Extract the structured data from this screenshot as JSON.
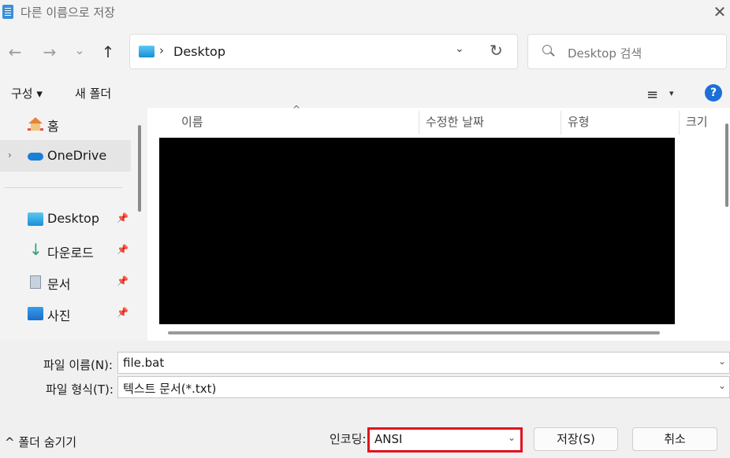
{
  "window": {
    "title": "다른 이름으로 저장",
    "close_glyph": "✕"
  },
  "nav": {
    "back": "←",
    "forward": "→",
    "recent": "⌄",
    "up": "↑",
    "address_sep": "›",
    "address": "Desktop",
    "address_dd": "⌄",
    "refresh": "↻",
    "search_placeholder": "Desktop 검색"
  },
  "commands": {
    "organize": "구성 ▾",
    "new_folder": "새 폴더",
    "view_icon": "≡",
    "view_dd": "▾",
    "help": "?"
  },
  "sidebar": {
    "items": [
      {
        "label": "홈",
        "icon": "home-icon"
      },
      {
        "label": "OneDrive",
        "icon": "onedrive-icon",
        "expander": "›"
      },
      {
        "label": "Desktop",
        "icon": "desktop-folder-icon",
        "pin": "📌"
      },
      {
        "label": "다운로드",
        "icon": "download-icon",
        "pin": "📌"
      },
      {
        "label": "문서",
        "icon": "document-icon",
        "pin": "📌"
      },
      {
        "label": "사진",
        "icon": "pictures-icon",
        "pin": "📌"
      }
    ]
  },
  "columns": [
    "이름",
    "수정한 날짜",
    "유형",
    "크기"
  ],
  "sort_arrow": "^",
  "form": {
    "filename_label": "파일 이름(N):",
    "filename": "file.bat",
    "filetype_label": "파일 형식(T):",
    "filetype": "텍스트 문서(*.txt)",
    "dd": "⌄",
    "hide_folders": "^ 폴더 숨기기",
    "encoding_label": "인코딩:",
    "encoding": "ANSI",
    "save": "저장(S)",
    "cancel": "취소"
  },
  "colors": {
    "highlight": "#e3101e",
    "help": "#1a6fd8"
  }
}
